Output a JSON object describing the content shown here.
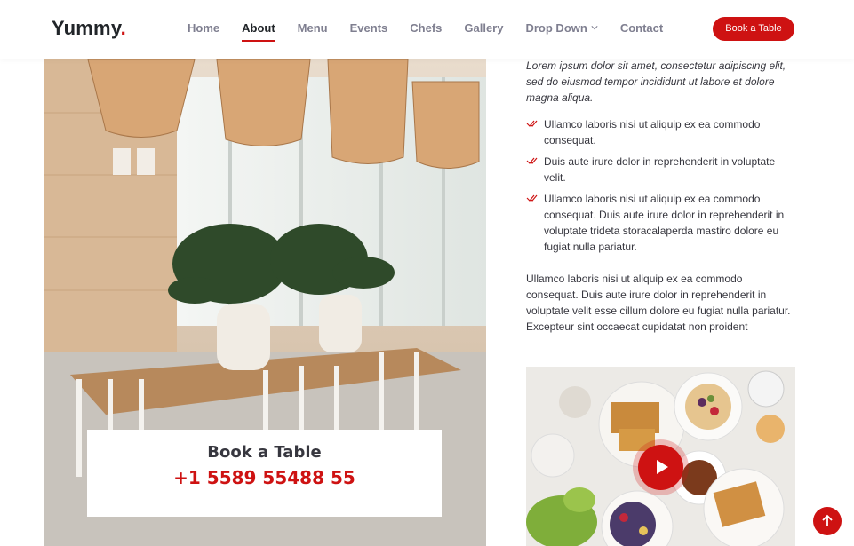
{
  "header": {
    "logo": "Yummy",
    "logo_dot": ".",
    "nav": [
      {
        "label": "Home",
        "active": false
      },
      {
        "label": "About",
        "active": true
      },
      {
        "label": "Menu",
        "active": false
      },
      {
        "label": "Events",
        "active": false
      },
      {
        "label": "Chefs",
        "active": false
      },
      {
        "label": "Gallery",
        "active": false
      },
      {
        "label": "Drop Down",
        "active": false,
        "icon": "chevron-down-icon"
      },
      {
        "label": "Contact",
        "active": false
      }
    ],
    "cta_label": "Book a Table"
  },
  "left": {
    "photo_icon": "restaurant-interior-photo",
    "book_title": "Book a Table",
    "phone": "+1 5589 55488 55"
  },
  "right": {
    "intro": "Lorem ipsum dolor sit amet, consectetur adipiscing elit, sed do eiusmod tempor incididunt ut labore et dolore magna aliqua.",
    "checks": [
      "Ullamco laboris nisi ut aliquip ex ea commodo consequat.",
      "Duis aute irure dolor in reprehenderit in voluptate velit.",
      "Ullamco laboris nisi ut aliquip ex ea commodo consequat. Duis aute irure dolor in reprehenderit in voluptate trideta storacalaperda mastiro dolore eu fugiat nulla pariatur."
    ],
    "paragraph": "Ullamco laboris nisi ut aliquip ex ea commodo consequat. Duis aute irure dolor in reprehenderit in voluptate velit esse cillum dolore eu fugiat nulla pariatur. Excepteur sint occaecat cupidatat non proident"
  },
  "video": {
    "icon": "play-icon"
  },
  "scroll_top": {
    "icon": "arrow-up-icon"
  },
  "colors": {
    "accent": "#ce1212",
    "text": "#37373f",
    "nav": "#7f7f90"
  }
}
